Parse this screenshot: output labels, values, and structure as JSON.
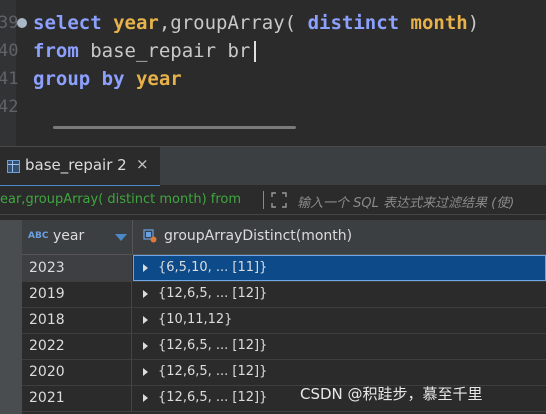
{
  "editor": {
    "lines": [
      {
        "number": "39",
        "tokens": [
          {
            "t": "select ",
            "c": "kw"
          },
          {
            "t": "year",
            "c": "col"
          },
          {
            "t": ",groupArray( ",
            "c": "fn"
          },
          {
            "t": "distinct ",
            "c": "kw"
          },
          {
            "t": "month",
            "c": "col"
          },
          {
            "t": ")",
            "c": "fn"
          }
        ]
      },
      {
        "number": "40",
        "tokens": [
          {
            "t": "from ",
            "c": "kw"
          },
          {
            "t": "base_repair br",
            "c": "fn"
          }
        ]
      },
      {
        "number": "41",
        "tokens": [
          {
            "t": "group ",
            "c": "kw"
          },
          {
            "t": "by ",
            "c": "kw"
          },
          {
            "t": "year",
            "c": "col"
          }
        ]
      },
      {
        "number": "42",
        "tokens": []
      }
    ]
  },
  "results_tab": {
    "label": "base_repair 2",
    "close": "×"
  },
  "filter": {
    "query_text": "ear,groupArray( distinct month) from",
    "placeholder": "输入一个 SQL 表达式来过滤结果 (使)"
  },
  "grid": {
    "columns": [
      {
        "type_badge": "ABC",
        "label": "year"
      },
      {
        "label": "groupArrayDistinct(month)"
      }
    ],
    "rows": [
      {
        "year": "2023",
        "value": "{6,5,10, ... [11]}",
        "selected": true
      },
      {
        "year": "2019",
        "value": "{12,6,5, ... [12]}",
        "selected": false
      },
      {
        "year": "2018",
        "value": "{10,11,12}",
        "selected": false
      },
      {
        "year": "2022",
        "value": "{12,6,5, ... [12]}",
        "selected": false
      },
      {
        "year": "2020",
        "value": "{12,6,5, ... [12]}",
        "selected": false
      },
      {
        "year": "2021",
        "value": "{12,6,5, ... [12]}",
        "selected": false
      }
    ]
  },
  "watermark": "CSDN @积跬步，慕至千里",
  "colors": {
    "keyword": "#8ca0ff",
    "column": "#e8b24a",
    "selection": "#0d4a8a",
    "filter_query": "#3fa63f"
  }
}
